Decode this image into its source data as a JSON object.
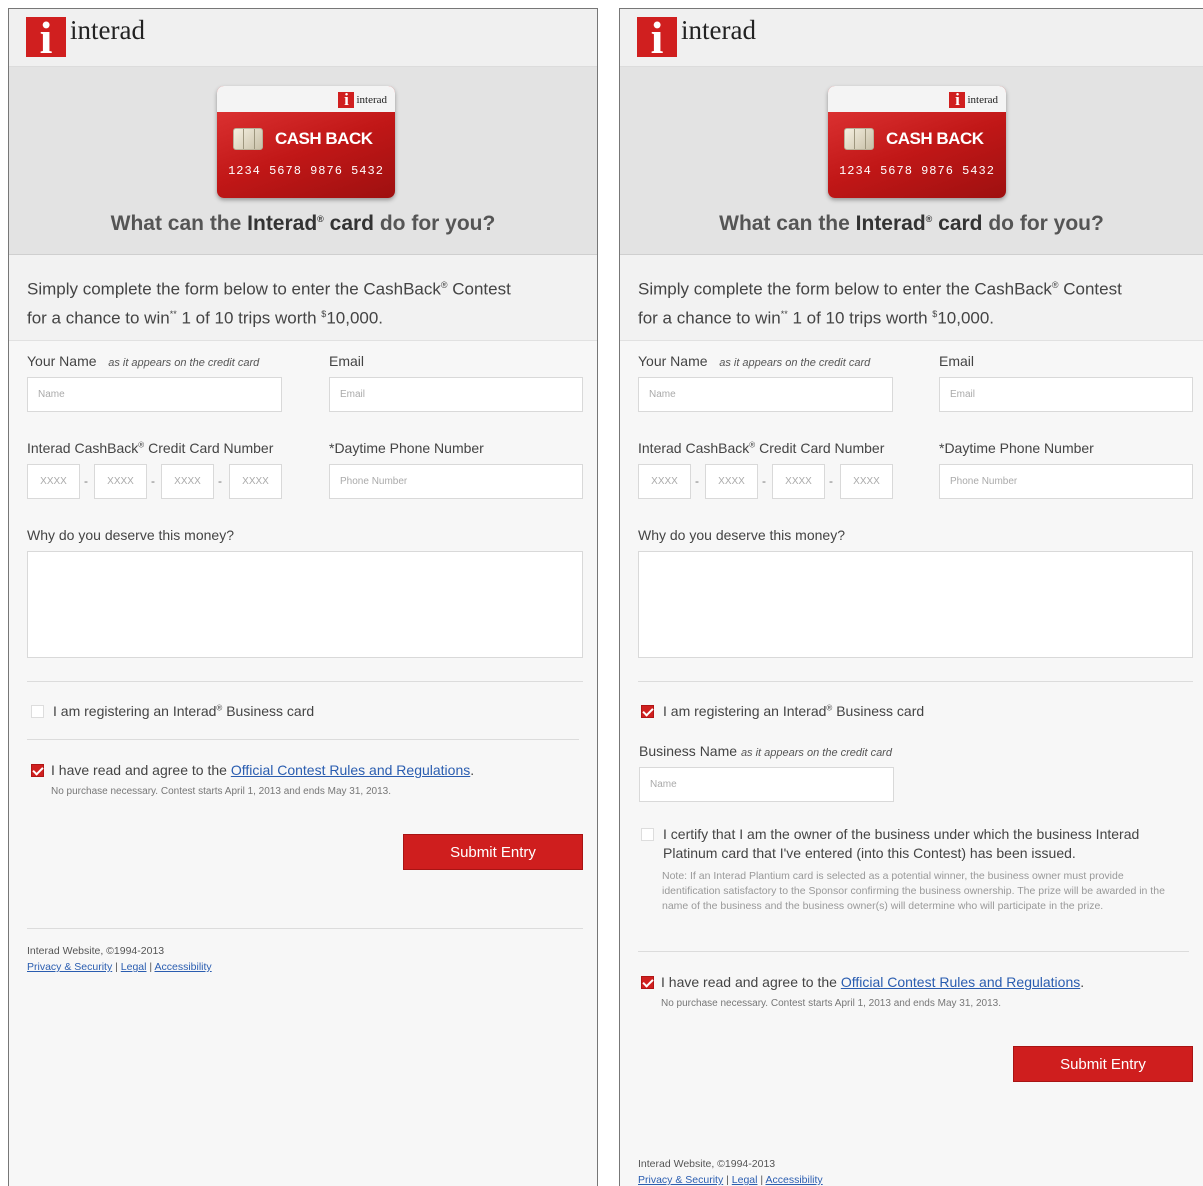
{
  "brand": {
    "logo_glyph": "i",
    "logo_text": "interad"
  },
  "card": {
    "logo_text": "interad",
    "title": "CASH BACK",
    "number": "1234 5678 9876 5432"
  },
  "hero": {
    "title_pre": "What can the ",
    "title_bold": "Interad",
    "title_mark": "®",
    "title_mid": " card",
    "title_post": " do for you?"
  },
  "intro": {
    "line1_a": "Simply complete the form below to enter the CashBack",
    "line1_mark": "®",
    "line1_b": " Contest",
    "line2_a": "for a chance to win",
    "line2_mark": "**",
    "line2_b": " 1 of 10 trips worth ",
    "line2_cur": "$",
    "line2_c": "10,000."
  },
  "form": {
    "name_label": "Your Name",
    "name_hint": "as it appears on the credit card",
    "name_placeholder": "Name",
    "email_label": "Email",
    "email_placeholder": "Email",
    "cc_label_a": "Interad CashBack",
    "cc_label_mark": "®",
    "cc_label_b": " Credit Card Number",
    "cc_seg_placeholder": "XXXX",
    "phone_label": "*Daytime Phone Number",
    "phone_placeholder": "Phone Number",
    "why_label": "Why do you deserve this money?",
    "business_cb_a": "I am registering an Interad",
    "business_cb_mark": "®",
    "business_cb_b": " Business card",
    "business_name_label": "Business Name",
    "business_name_hint": "as it appears on the credit card",
    "business_name_placeholder": "Name",
    "certify_text": "I certify that I am the owner of the business under which the business Interad Platinum card that I've entered (into this Contest) has been issued.",
    "certify_note": "Note: If an Interad Plantium card is selected as a potential winner, the business owner must provide identification satisfactory to the Sponsor confirming the business ownership. The prize will be awarded in the name of the business and the business owner(s) will determine who will participate in the prize.",
    "agree_pre": "I have read and agree to the ",
    "agree_link": "Official Contest Rules and Regulations",
    "agree_post": ".",
    "agree_note": "No purchase necessary. Contest starts April 1, 2013 and ends May 31, 2013.",
    "submit_label": "Submit Entry"
  },
  "footer": {
    "copyright": "Interad Website, ©1994-2013",
    "link_privacy": "Privacy & Security",
    "link_legal": "Legal",
    "link_access": "Accessibility",
    "sep": "|"
  },
  "state": {
    "left_business_checked": false,
    "left_agree_checked": true,
    "right_business_checked": true,
    "right_certify_checked": false,
    "right_agree_checked": true
  },
  "colors": {
    "brand_red": "#d01f1f",
    "link_blue": "#2a5db0"
  }
}
